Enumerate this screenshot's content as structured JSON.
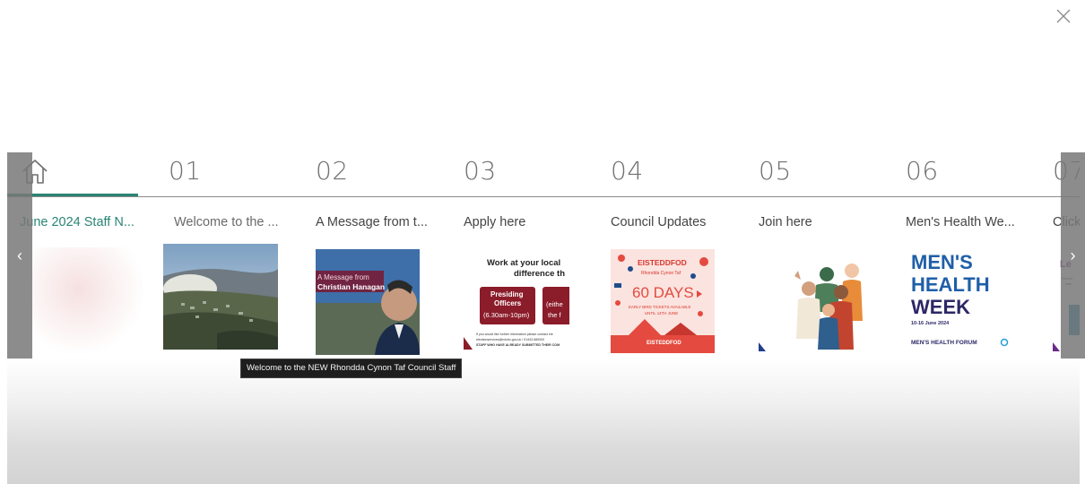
{
  "tabs": [
    {
      "num": "",
      "title": "June 2024 Staff N...",
      "icon": "home-icon"
    },
    {
      "num": "01",
      "title": "Welcome to the ..."
    },
    {
      "num": "02",
      "title": "A Message from t..."
    },
    {
      "num": "03",
      "title": "Apply here"
    },
    {
      "num": "04",
      "title": "Council Updates"
    },
    {
      "num": "05",
      "title": "Join here"
    },
    {
      "num": "06",
      "title": "Men's Health We..."
    },
    {
      "num": "07",
      "title": "Click"
    }
  ],
  "thumbs": {
    "t2": {
      "line1": "A Message from",
      "line2": "Christian Hanagan"
    },
    "t3": {
      "head1": "Work at your local",
      "head2": "difference th",
      "btn1a": "Presiding",
      "btn1b": "Officers",
      "btn1c": "(6.30am-10pm)",
      "btn2a": "(eithe",
      "btn2b": "the f",
      "foot1": "If you would like further information please contact ele",
      "foot2": "electionservices@rctcbc.gov.uk / 01443 680000",
      "foot3": "STAFF WHO HAVE ALREADY SUBMITTED THEIR COM"
    },
    "t4": {
      "brand": "EISTEDDFOD",
      "sub": "Rhondda Cynon Taf",
      "days": "60 DAYS",
      "early1": "EARLY BIRD TICKETS AVAILABLE",
      "early2": "UNTIL 14TH JUNE",
      "foot": "EISTEDDFOD"
    },
    "t6": {
      "l1": "MEN'S",
      "l2": "HEALTH",
      "l3": "WEEK",
      "date": "10-16 June 2024",
      "forum": "MEN'S HEALTH FORUM"
    },
    "t7": {
      "a": "Le",
      "b": "Rhond",
      "c": "pain"
    }
  },
  "tooltip": "Welcome to the NEW Rhondda Cynon Taf Council Staff",
  "colors": {
    "accent": "#2a8574",
    "maroon": "#8b1c2a",
    "mhBlue": "#1f5fa8",
    "mhPurple": "#2c2766"
  }
}
